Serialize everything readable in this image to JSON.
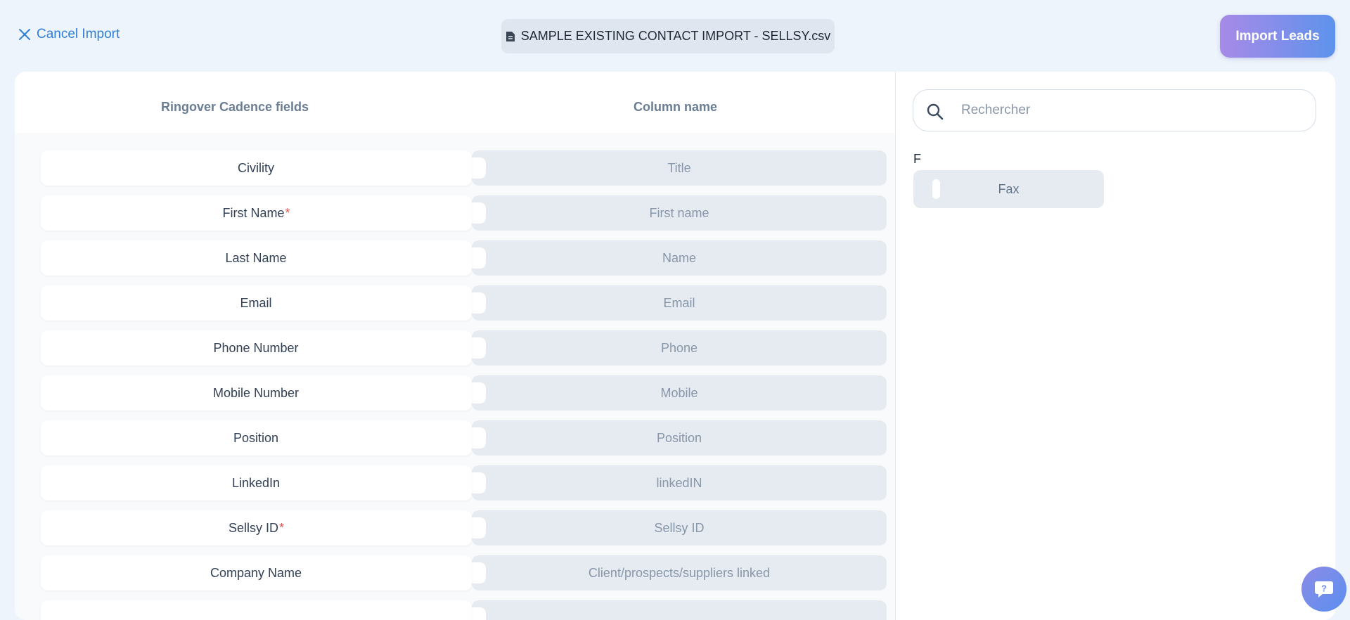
{
  "header": {
    "cancel_label": "Cancel Import",
    "file_name": "SAMPLE EXISTING CONTACT IMPORT - SELLSY.csv",
    "import_label": "Import Leads"
  },
  "table": {
    "col_fields": "Ringover Cadence fields",
    "col_column": "Column name",
    "rows": [
      {
        "field": "Civility",
        "required": "",
        "column": "Title"
      },
      {
        "field": "First Name",
        "required": "*",
        "column": "First name"
      },
      {
        "field": "Last Name",
        "required": "",
        "column": "Name"
      },
      {
        "field": "Email",
        "required": "",
        "column": "Email"
      },
      {
        "field": "Phone Number",
        "required": "",
        "column": "Phone"
      },
      {
        "field": "Mobile Number",
        "required": "",
        "column": "Mobile"
      },
      {
        "field": "Position",
        "required": "",
        "column": "Position"
      },
      {
        "field": "LinkedIn",
        "required": "",
        "column": "linkedIN"
      },
      {
        "field": "Sellsy ID",
        "required": "*",
        "column": "Sellsy ID"
      },
      {
        "field": "Company Name",
        "required": "",
        "column": "Client/prospects/suppliers linked"
      },
      {
        "field": "",
        "required": "",
        "column": ""
      }
    ]
  },
  "sidebar": {
    "search_placeholder": "Rechercher",
    "group_letter": "F",
    "items": [
      {
        "label": "Fax"
      }
    ]
  },
  "colors": {
    "accent": "#2f7fd6",
    "required": "#e45656",
    "gradient_start": "#a88ae8",
    "gradient_end": "#5d93ec"
  },
  "icons": [
    "close-icon",
    "file-icon",
    "search-icon",
    "help-icon"
  ]
}
